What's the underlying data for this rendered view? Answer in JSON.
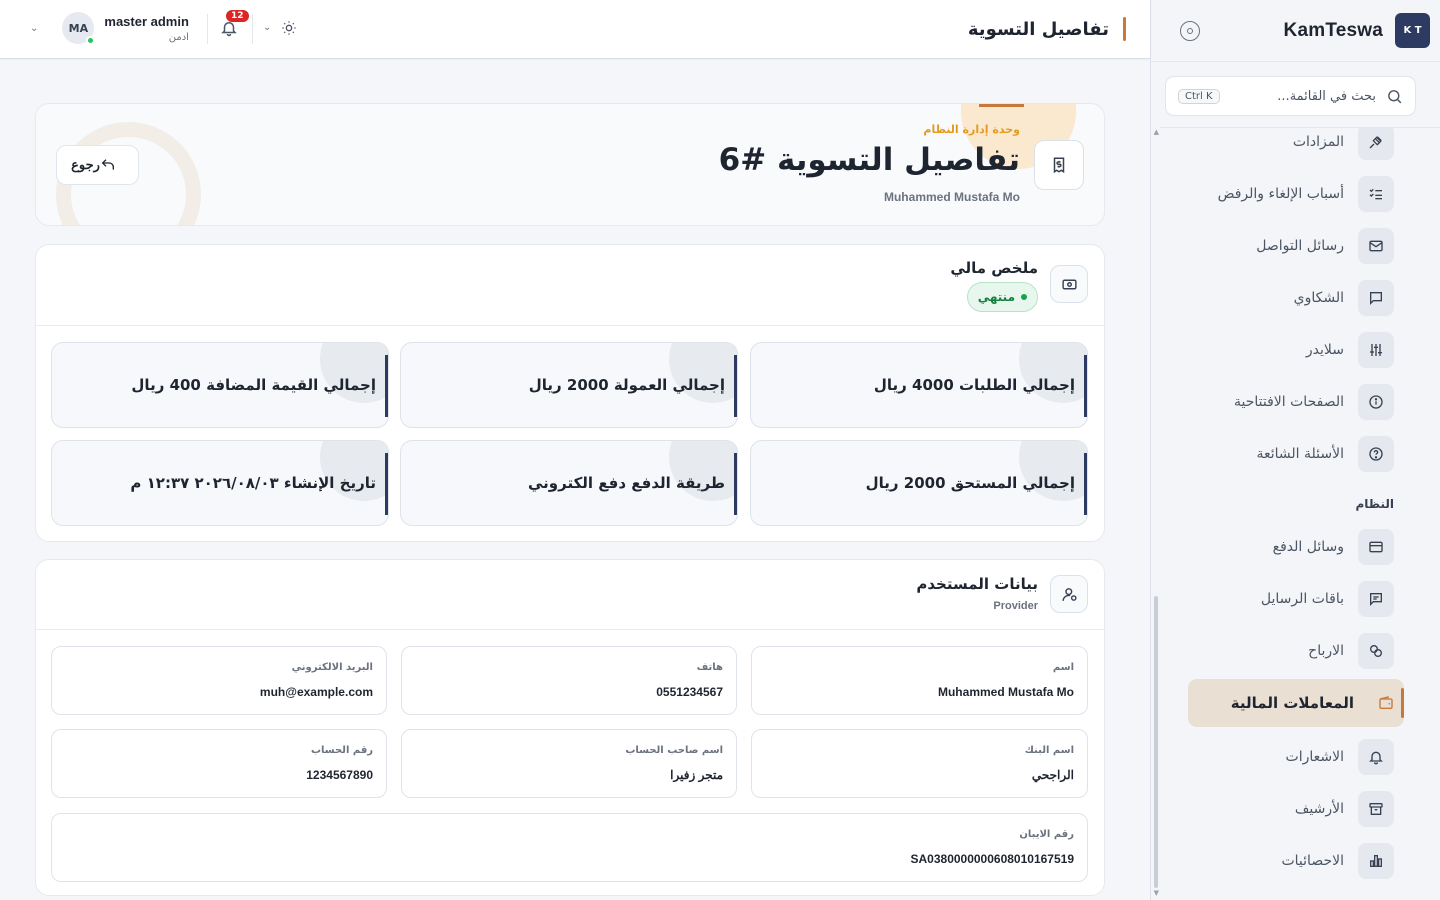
{
  "app": {
    "brand": "KamTeswa",
    "logo_top": "K T",
    "logo_bottom": "T"
  },
  "search": {
    "placeholder": "بحث في القائمة...",
    "shortcut": "Ctrl K"
  },
  "sidebar": {
    "items": [
      {
        "label": "المزادات",
        "icon": "gavel-icon"
      },
      {
        "label": "أسباب الإلغاء والرفض",
        "icon": "checklist-icon"
      },
      {
        "label": "رسائل التواصل",
        "icon": "mail-icon"
      },
      {
        "label": "الشكاوي",
        "icon": "message-square-icon"
      },
      {
        "label": "سلايدر",
        "icon": "sliders-icon"
      },
      {
        "label": "الصفحات الافتتاحية",
        "icon": "info-icon"
      },
      {
        "label": "الأسئلة الشائعة",
        "icon": "help-circle-icon"
      }
    ],
    "section_system": "النظام",
    "system_items": [
      {
        "label": "وسائل الدفع",
        "icon": "credit-card-icon"
      },
      {
        "label": "باقات الرسايل",
        "icon": "message-icon"
      },
      {
        "label": "الارباح",
        "icon": "coins-icon"
      },
      {
        "label": "المعاملات المالية",
        "icon": "wallet-icon",
        "active": true
      },
      {
        "label": "الاشعارات",
        "icon": "bell-icon"
      },
      {
        "label": "الأرشيف",
        "icon": "archive-icon"
      },
      {
        "label": "الاحصائيات",
        "icon": "bar-chart-icon"
      }
    ]
  },
  "header": {
    "title": "تفاصيل التسوية",
    "user_name": "master admin",
    "user_role": "ادمن",
    "avatar_initials": "MA",
    "notifications_count": "12"
  },
  "hero": {
    "module": "وحدة إدارة النظام",
    "title": "تفاصيل التسوية #6",
    "name": "Muhammed Mustafa Mo",
    "back_label": "رجوع"
  },
  "financial": {
    "title": "ملخص مالي",
    "status": "منتهي",
    "stats": [
      {
        "label": "إجمالي الطلبات",
        "value": "4000",
        "unit": "ريال",
        "text": "إجمالي الطلبات 4000 ريال"
      },
      {
        "label": "إجمالي العمولة",
        "value": "2000",
        "unit": "ريال",
        "text": "إجمالي العمولة 2000 ريال"
      },
      {
        "label": "إجمالي القيمة المضافة",
        "value": "400",
        "unit": "ريال",
        "text": "إجمالي القيمة المضافة 400 ريال"
      },
      {
        "label": "إجمالي المستحق",
        "value": "2000",
        "unit": "ريال",
        "text": "إجمالي المستحق 2000 ريال"
      },
      {
        "label": "طريقة الدفع",
        "value": "دفع الكتروني",
        "text": "طريقة الدفع دفع الكتروني"
      },
      {
        "label": "تاريخ الإنشاء",
        "value": "٢٠٢٦/٠٨/٠٣ ١٢:٣٧ م",
        "text": "تاريخ الإنشاء ٢٠٢٦/٠٨/٠٣ ١٢:٣٧ م"
      }
    ]
  },
  "user_info": {
    "title": "بيانات المستخدم",
    "role": "Provider",
    "fields": [
      {
        "label": "اسم",
        "value": "Muhammed Mustafa Mo"
      },
      {
        "label": "هاتف",
        "value": "0551234567"
      },
      {
        "label": "البريد الالكتروني",
        "value": "muh@example.com"
      },
      {
        "label": "اسم البنك",
        "value": "الراجحي"
      },
      {
        "label": "اسم صاحب الحساب",
        "value": "متجر زفيرا"
      },
      {
        "label": "رقم الحساب",
        "value": "1234567890"
      },
      {
        "label": "رقم الايبان",
        "value": "SA0380000000608010167519"
      }
    ]
  },
  "colors": {
    "accent": "#c7783a",
    "navy": "#2d3a62",
    "success": "#15803d",
    "danger": "#dc2626"
  }
}
